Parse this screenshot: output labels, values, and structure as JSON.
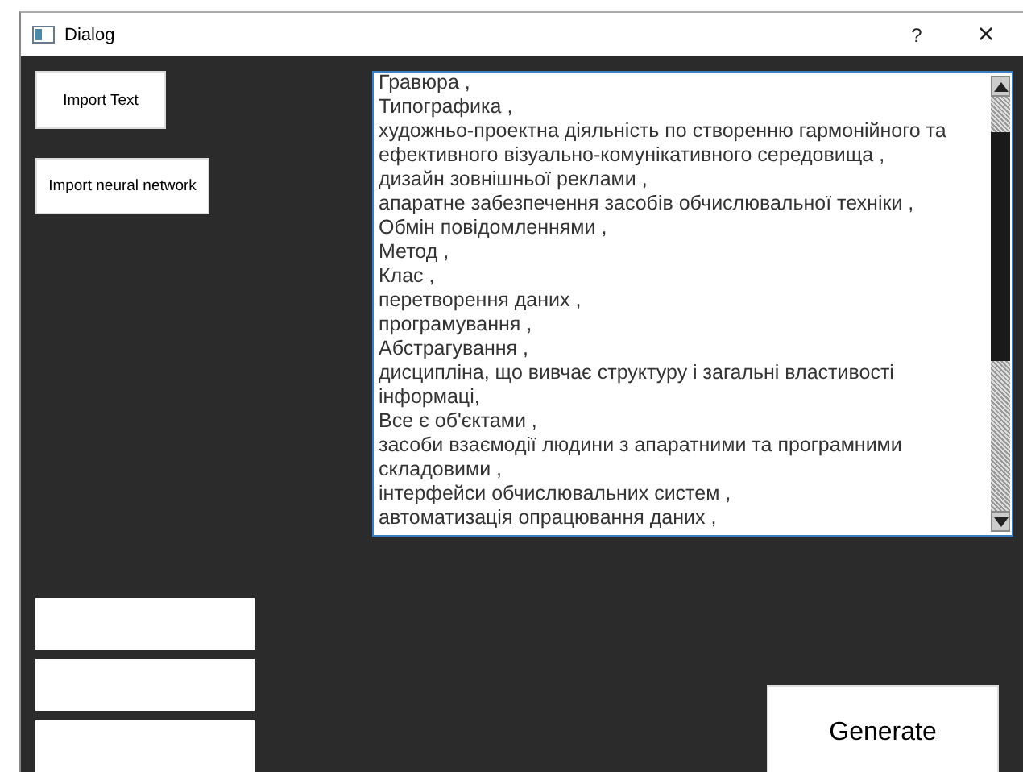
{
  "window": {
    "title": "Dialog",
    "help": "?",
    "close": "×"
  },
  "buttons": [
    "Import Text",
    "Import neural network"
  ],
  "text_area": {
    "lines": [
      "Гравюра ,",
      "Типографика ,",
      "художньо-проектна діяльність по створенню гармонійного та ефективного візуально-комунікативного середовища ,",
      "дизайн зовнішньої реклами ,",
      "апаратне забезпечення засобів обчислювальної техніки ,",
      "Обмін повідомленнями ,",
      "Метод ,",
      "Клас ,",
      "перетворення даних ,",
      "програмування ,",
      "Абстрагування ,",
      "дисципліна, що вивчає структуру і загальні властивості інформаці,",
      "Все є об'єктами ,",
      "засоби взаємодії людини з апаратними та програмними складовими ,",
      "інтерфейси обчислювальних систем ,",
      "автоматизація опрацювання даних ,"
    ]
  },
  "fields": [
    {
      "kind": "input"
    },
    {
      "kind": "input"
    },
    {
      "kind": "input"
    }
  ],
  "generate_button": "Generate"
}
